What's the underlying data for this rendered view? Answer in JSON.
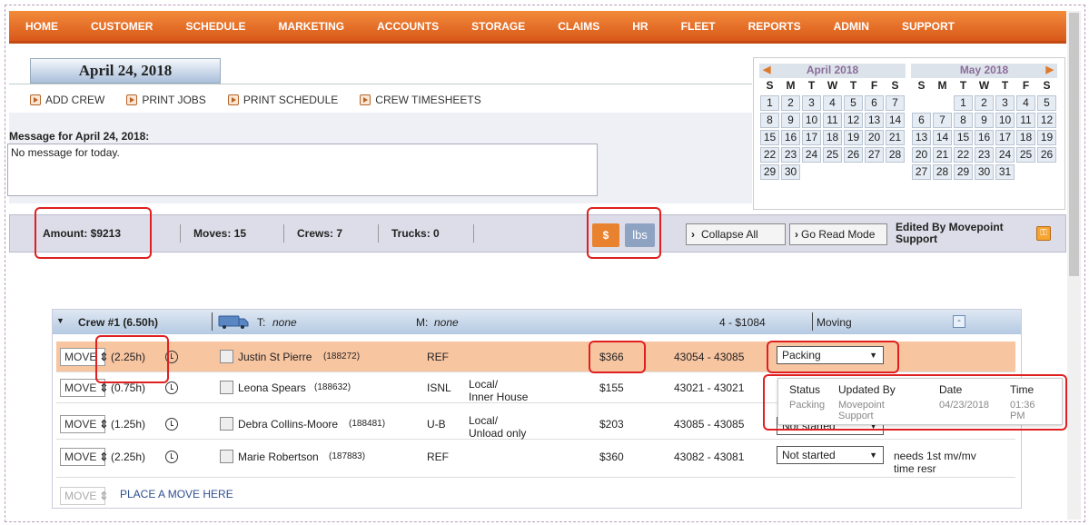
{
  "nav": [
    "HOME",
    "CUSTOMER",
    "SCHEDULE",
    "MARKETING",
    "ACCOUNTS",
    "STORAGE",
    "CLAIMS",
    "HR",
    "FLEET",
    "REPORTS",
    "ADMIN",
    "SUPPORT"
  ],
  "date_tab": "April 24, 2018",
  "actions": [
    "ADD CREW",
    "PRINT JOBS",
    "PRINT SCHEDULE",
    "CREW TIMESHEETS"
  ],
  "message_label": "Message for April 24, 2018:",
  "message_text": "No message for today.",
  "calendar": {
    "april": {
      "title": "April 2018",
      "dow": [
        "S",
        "M",
        "T",
        "W",
        "T",
        "F",
        "S"
      ],
      "weeks": [
        [
          "1",
          "2",
          "3",
          "4",
          "5",
          "6",
          "7"
        ],
        [
          "8",
          "9",
          "10",
          "11",
          "12",
          "13",
          "14"
        ],
        [
          "15",
          "16",
          "17",
          "18",
          "19",
          "20",
          "21"
        ],
        [
          "22",
          "23",
          "24",
          "25",
          "26",
          "27",
          "28"
        ],
        [
          "29",
          "30",
          "",
          "",
          "",
          "",
          ""
        ]
      ]
    },
    "may": {
      "title": "May 2018",
      "dow": [
        "S",
        "M",
        "T",
        "W",
        "T",
        "F",
        "S"
      ],
      "weeks": [
        [
          "",
          "",
          "1",
          "2",
          "3",
          "4",
          "5"
        ],
        [
          "6",
          "7",
          "8",
          "9",
          "10",
          "11",
          "12"
        ],
        [
          "13",
          "14",
          "15",
          "16",
          "17",
          "18",
          "19"
        ],
        [
          "20",
          "21",
          "22",
          "23",
          "24",
          "25",
          "26"
        ],
        [
          "27",
          "28",
          "29",
          "30",
          "31",
          "",
          ""
        ]
      ]
    }
  },
  "stats": {
    "amount": "Amount: $9213",
    "moves": "Moves: 15",
    "crews": "Crews: 7",
    "trucks": "Trucks: 0"
  },
  "toggle": {
    "dollar": "$",
    "lbs": "lbs"
  },
  "buttons": {
    "collapse": "Collapse All",
    "read_mode": "Go Read Mode"
  },
  "edited_by": "Edited By Movepoint Support",
  "crew": {
    "name": "Crew #1 (6.50h)",
    "truck": "T:",
    "truck_val": "none",
    "mover": "M:",
    "mover_val": "none",
    "summary": "4 - $1084",
    "status": "Moving",
    "collapse": "-"
  },
  "rows": [
    {
      "move": "MOVE",
      "hours": "(2.25h)",
      "name": "Justin St Pierre",
      "id": "(188272)",
      "type": "REF",
      "desc1": "",
      "desc2": "",
      "amount": "$366",
      "zip": "43054 - 43085",
      "status": "Packing",
      "note": "",
      "note2": ""
    },
    {
      "move": "MOVE",
      "hours": "(0.75h)",
      "name": "Leona Spears",
      "id": "(188632)",
      "type": "ISNL",
      "desc1": "Local/",
      "desc2": "Inner House",
      "amount": "$155",
      "zip": "43021 - 43021",
      "status": "",
      "note": "",
      "note2": ""
    },
    {
      "move": "MOVE",
      "hours": "(1.25h)",
      "name": "Debra Collins-Moore",
      "id": "(188481)",
      "type": "U-B",
      "desc1": "Local/",
      "desc2": "Unload only",
      "amount": "$203",
      "zip": "43085 - 43085",
      "status": "Not started",
      "note": "",
      "note2": ""
    },
    {
      "move": "MOVE",
      "hours": "(2.25h)",
      "name": "Marie Robertson",
      "id": "(187883)",
      "type": "REF",
      "desc1": "",
      "desc2": "",
      "amount": "$360",
      "zip": "43082 - 43081",
      "status": "Not started",
      "note": "needs 1st mv/mv",
      "note2": "time resr"
    }
  ],
  "place_move": "PLACE A MOVE HERE",
  "popup": {
    "headers": [
      "Status",
      "Updated By",
      "Date",
      "Time"
    ],
    "status": "Packing",
    "by1": "Movepoint",
    "by2": "Support",
    "date": "04/23/2018",
    "time1": "01:36",
    "time2": "PM"
  },
  "colors": {
    "nav": "#e0661f",
    "highlight": "#f8c5a1",
    "annotation": "#e02020"
  }
}
